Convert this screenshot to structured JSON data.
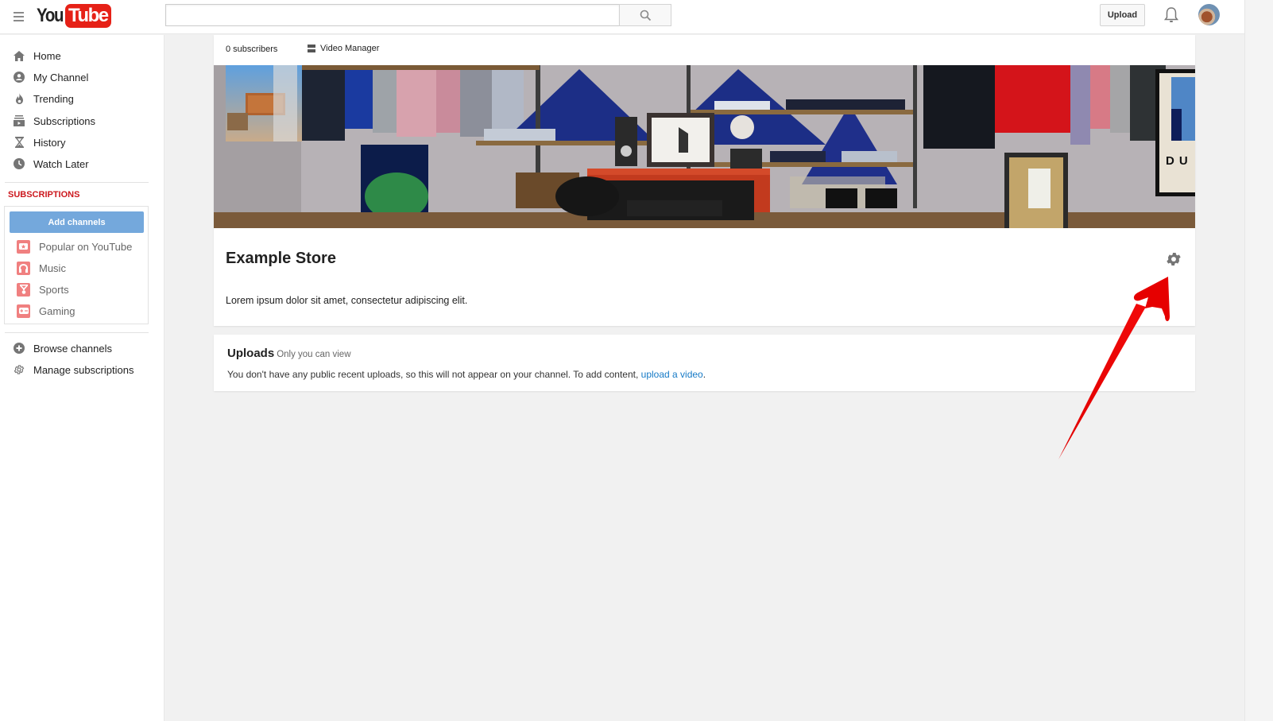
{
  "masthead": {
    "logo_you": "You",
    "logo_tube": "Tube",
    "search_placeholder": "",
    "search_value": "",
    "upload_label": "Upload",
    "icons": {
      "guide": "hamburger-menu-icon",
      "search": "search-icon",
      "notifications": "bell-icon",
      "avatar": "avatar"
    }
  },
  "sidebar": {
    "nav": [
      {
        "label": "Home",
        "icon": "home-icon"
      },
      {
        "label": "My Channel",
        "icon": "person-circle-icon"
      },
      {
        "label": "Trending",
        "icon": "flame-icon"
      },
      {
        "label": "Subscriptions",
        "icon": "subscriptions-icon"
      },
      {
        "label": "History",
        "icon": "hourglass-icon"
      },
      {
        "label": "Watch Later",
        "icon": "clock-icon"
      }
    ],
    "subscriptions_title": "SUBSCRIPTIONS",
    "add_channels_label": "Add channels",
    "subscriptions": [
      {
        "label": "Popular on YouTube",
        "icon": "star-tv-icon"
      },
      {
        "label": "Music",
        "icon": "headphones-icon"
      },
      {
        "label": "Sports",
        "icon": "trophy-icon"
      },
      {
        "label": "Gaming",
        "icon": "gamepad-icon"
      }
    ],
    "footer": [
      {
        "label": "Browse channels",
        "icon": "plus-circle-icon"
      },
      {
        "label": "Manage subscriptions",
        "icon": "gear-icon"
      }
    ]
  },
  "channel": {
    "subscriber_count": "0 subscribers",
    "video_manager_label": "Video Manager",
    "title": "Example Store",
    "description": "Lorem ipsum dolor sit amet, consectetur adipiscing elit.",
    "banner_poster_text": "DU",
    "settings_icon": "gear-icon"
  },
  "uploads": {
    "title": "Uploads",
    "visibility": "Only you can view",
    "message_prefix": "You don't have any public recent uploads, so this will not appear on your channel. To add content, ",
    "link_text": "upload a video",
    "message_suffix": "."
  },
  "annotation": {
    "type": "arrow",
    "color": "#e60000",
    "points_to": "channel-settings-gear"
  },
  "colors": {
    "brand_red": "#e62117",
    "subs_title_red": "#cc181e",
    "add_channels_blue": "#74a8dc",
    "link_blue": "#167ac6",
    "sub_icon_pink": "#f08080",
    "page_bg": "#f1f1f1"
  }
}
